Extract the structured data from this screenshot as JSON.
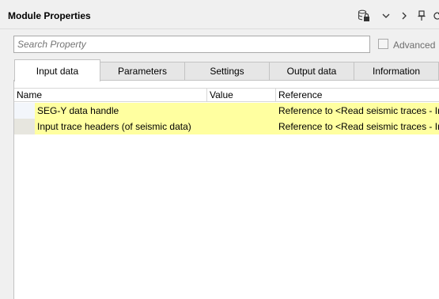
{
  "panel": {
    "title": "Module Properties",
    "toolbar_icons": [
      "database-lock-icon",
      "chevron-down-icon",
      "chevron-right-icon",
      "pin-icon",
      "refresh-icon"
    ]
  },
  "search": {
    "placeholder": "Search Property",
    "value": ""
  },
  "advanced": {
    "label": "Advanced",
    "checked": false
  },
  "tabs": [
    {
      "label": "Input data",
      "active": true
    },
    {
      "label": "Parameters",
      "active": false
    },
    {
      "label": "Settings",
      "active": false
    },
    {
      "label": "Output data",
      "active": false
    },
    {
      "label": "Information",
      "active": false
    }
  ],
  "table": {
    "columns": [
      "Name",
      "Value",
      "Reference"
    ],
    "rows": [
      {
        "name": "SEG-Y data handle",
        "value": "",
        "reference": "Reference to <Read seismic traces - Inp"
      },
      {
        "name": "Input trace headers (of seismic data)",
        "value": "",
        "reference": "Reference to <Read seismic traces - Inp"
      }
    ]
  },
  "colors": {
    "row_highlight": "#ffffa0",
    "row_gutter_1": "#f3f6fb",
    "row_gutter_2": "#e7e6df",
    "panel_bg": "#f0f0f0"
  }
}
